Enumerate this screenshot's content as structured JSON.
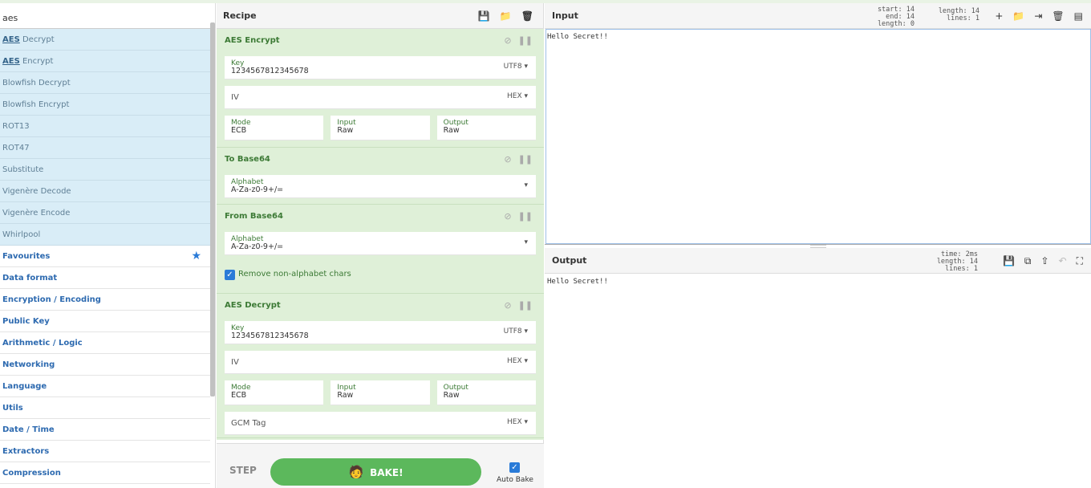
{
  "search": {
    "value": "aes"
  },
  "operations": [
    {
      "match": "AES",
      "rest": " Decrypt"
    },
    {
      "match": "AES",
      "rest": " Encrypt"
    },
    {
      "match": "",
      "rest": "Blowfish Decrypt"
    },
    {
      "match": "",
      "rest": "Blowfish Encrypt"
    },
    {
      "match": "",
      "rest": "ROT13"
    },
    {
      "match": "",
      "rest": "ROT47"
    },
    {
      "match": "",
      "rest": "Substitute"
    },
    {
      "match": "",
      "rest": "Vigenère Decode"
    },
    {
      "match": "",
      "rest": "Vigenère Encode"
    },
    {
      "match": "",
      "rest": "Whirlpool"
    }
  ],
  "categories": [
    "Favourites",
    "Data format",
    "Encryption / Encoding",
    "Public Key",
    "Arithmetic / Logic",
    "Networking",
    "Language",
    "Utils",
    "Date / Time",
    "Extractors",
    "Compression"
  ],
  "icons": {
    "favourite": "star-icon",
    "save": "save-icon",
    "load": "folder-icon",
    "clear": "trash-icon",
    "disable": "disable-icon",
    "breakpoint": "pause-icon",
    "add_input": "plus-icon",
    "open_folder": "folder-icon",
    "open_file": "file-input-icon",
    "delete": "trash-icon",
    "layout": "layout-icon",
    "copy": "copy-icon",
    "replace_input": "replace-input-icon",
    "undo": "undo-icon",
    "maximise": "maximise-icon",
    "chef": "chef-icon"
  },
  "recipe": {
    "title": "Recipe",
    "aes_encrypt": {
      "title": "AES Encrypt",
      "key_label": "Key",
      "key_value": "1234567812345678",
      "key_enc": "UTF8",
      "iv_label": "IV",
      "iv_enc": "HEX",
      "mode_label": "Mode",
      "mode_value": "ECB",
      "input_label": "Input",
      "input_value": "Raw",
      "output_label": "Output",
      "output_value": "Raw"
    },
    "to_base64": {
      "title": "To Base64",
      "alphabet_label": "Alphabet",
      "alphabet_value": "A-Za-z0-9+/="
    },
    "from_base64": {
      "title": "From Base64",
      "alphabet_label": "Alphabet",
      "alphabet_value": "A-Za-z0-9+/=",
      "remove_label": "Remove non-alphabet chars",
      "remove_checked": true
    },
    "aes_decrypt": {
      "title": "AES Decrypt",
      "key_label": "Key",
      "key_value": "1234567812345678",
      "key_enc": "UTF8",
      "iv_label": "IV",
      "iv_enc": "HEX",
      "mode_label": "Mode",
      "mode_value": "ECB",
      "input_label": "Input",
      "input_value": "Raw",
      "output_label": "Output",
      "output_value": "Raw",
      "gcm_label": "GCM Tag",
      "gcm_enc": "HEX"
    }
  },
  "bake": {
    "step": "STEP",
    "label": "BAKE!",
    "auto_label": "Auto Bake",
    "auto_checked": true
  },
  "input": {
    "title": "Input",
    "text": "Hello Secret!!",
    "stats_a": [
      "start: 14",
      "end: 14",
      "length: 0"
    ],
    "stats_b": [
      "length: 14",
      "lines: 1"
    ]
  },
  "output": {
    "title": "Output",
    "text": "Hello Secret!!",
    "stats": [
      "time: 2ms",
      "length: 14",
      "lines: 1"
    ]
  }
}
